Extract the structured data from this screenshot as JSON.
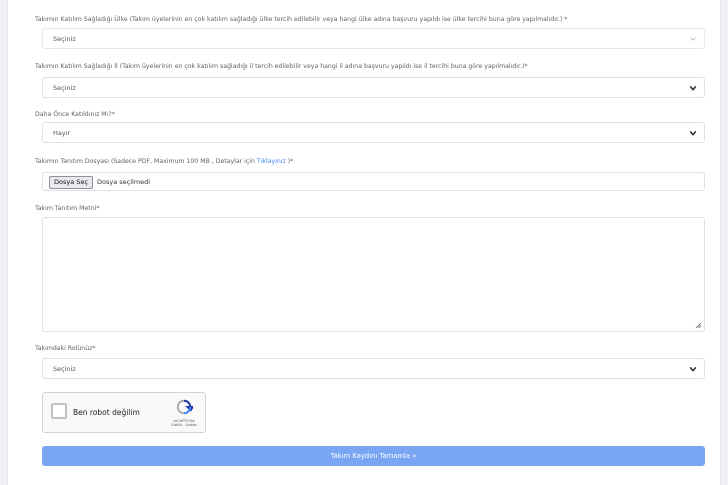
{
  "form": {
    "country": {
      "label": "Takımın Katılım Sağladığı Ülke (Takım üyelerinin en çok katılım sağladığı ülke tercih edilebilir veya hangi ülke adına başvuru yapıldı ise ülke tercihi buna göre yapılmalıdır.) *",
      "value": "Seçiniz"
    },
    "city": {
      "label": "Takımın Katılım Sağladığı İl (Takım üyelerinin en çok katılım sağladığı il tercih edilebilir veya hangi il adına başvuru yapıldı ise il tercihi buna göre yapılmalıdır.)*",
      "value": "Seçiniz"
    },
    "participated": {
      "label": "Daha Önce Katıldınız Mı?*",
      "value": "Hayır"
    },
    "intro_file": {
      "label_prefix": "Takımın Tanıtım Dosyası (Sadece PDF, Maximum 100 MB , Detaylar için",
      "link_text": "Tıklayınız",
      "label_suffix": ")*",
      "button_label": "Dosya Seç",
      "status": "Dosya seçilmedi"
    },
    "intro_text": {
      "label": "Takım Tanıtım Metni*",
      "value": ""
    },
    "role": {
      "label": "Takımdaki Rolünüz*",
      "value": "Seçiniz"
    },
    "captcha": {
      "label": "Ben robot değilim",
      "brand": "reCAPTCHA",
      "links": "Gizlilik - Şartlar"
    },
    "submit_label": "Takım Kaydını Tamamla »"
  },
  "colors": {
    "accent": "#7aa5f2",
    "link": "#3b82f6",
    "border": "#dde1e6"
  }
}
